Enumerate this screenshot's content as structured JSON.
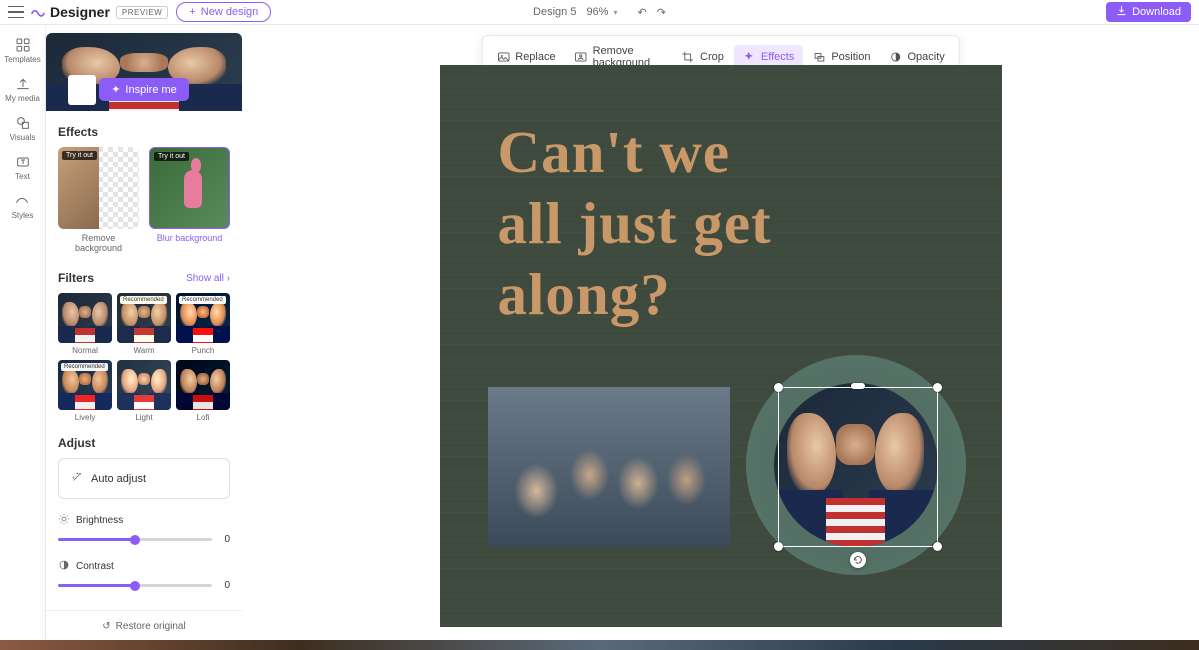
{
  "brand": "Designer",
  "preview_label": "PREVIEW",
  "new_design": "New design",
  "design_name": "Design 5",
  "zoom": "96%",
  "download": "Download",
  "leftbar": {
    "templates": "Templates",
    "mymedia": "My media",
    "visuals": "Visuals",
    "text": "Text",
    "styles": "Styles"
  },
  "inspire": "Inspire me",
  "sections": {
    "effects": "Effects",
    "filters": "Filters",
    "show_all": "Show all",
    "adjust": "Adjust"
  },
  "effects": {
    "try": "Try it out",
    "remove_bg": "Remove background",
    "blur_bg": "Blur background"
  },
  "filters": {
    "recommended": "Recommended",
    "normal": "Normal",
    "warm": "Warm",
    "punch": "Punch",
    "lively": "Lively",
    "light": "Light",
    "lofi": "Lofi"
  },
  "auto_adjust": "Auto adjust",
  "sliders": {
    "brightness": "Brightness",
    "brightness_val": "0",
    "contrast": "Contrast",
    "contrast_val": "0"
  },
  "restore": "Restore original",
  "toolbar": {
    "replace": "Replace",
    "remove_bg": "Remove background",
    "crop": "Crop",
    "effects": "Effects",
    "position": "Position",
    "opacity": "Opacity"
  },
  "canvas": {
    "headline_l1": "Can't we",
    "headline_l2": "all just get",
    "headline_l3": "along?"
  }
}
